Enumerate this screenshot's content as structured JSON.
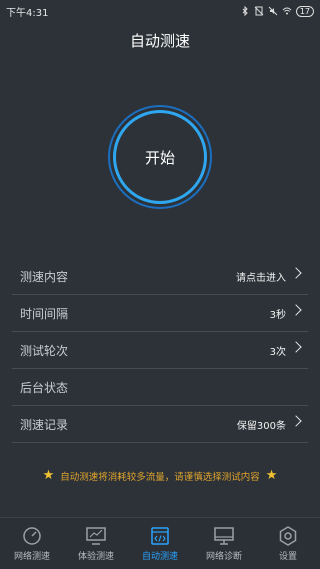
{
  "status_bar": {
    "time": "下午4:31",
    "battery": "17"
  },
  "header": {
    "title": "自动测速"
  },
  "start_button": {
    "label": "开始"
  },
  "settings": [
    {
      "label": "测速内容",
      "value": "请点击进入",
      "has_chevron": true
    },
    {
      "label": "时间间隔",
      "value": "3秒",
      "has_chevron": true
    },
    {
      "label": "测试轮次",
      "value": "3次",
      "has_chevron": true
    },
    {
      "label": "后台状态",
      "value": "",
      "has_chevron": false
    },
    {
      "label": "测速记录",
      "value": "保留300条",
      "has_chevron": true
    }
  ],
  "warning": {
    "text": "自动测速将消耗较多流量，请谨慎选择测试内容",
    "icon": "star-icon",
    "color": "#e1a42d"
  },
  "tabs": [
    {
      "label": "网络测速",
      "icon": "speedometer-icon",
      "active": false
    },
    {
      "label": "体验测速",
      "icon": "monitor-chart-icon",
      "active": false
    },
    {
      "label": "自动测速",
      "icon": "code-window-icon",
      "active": true
    },
    {
      "label": "网络诊断",
      "icon": "computer-icon",
      "active": false
    },
    {
      "label": "设置",
      "icon": "gear-icon",
      "active": false
    }
  ],
  "colors": {
    "background": "#2c3238",
    "accent": "#2aa4ff",
    "ring_inner": "#2fa7f0",
    "ring_outer": "#1c6fc0"
  }
}
